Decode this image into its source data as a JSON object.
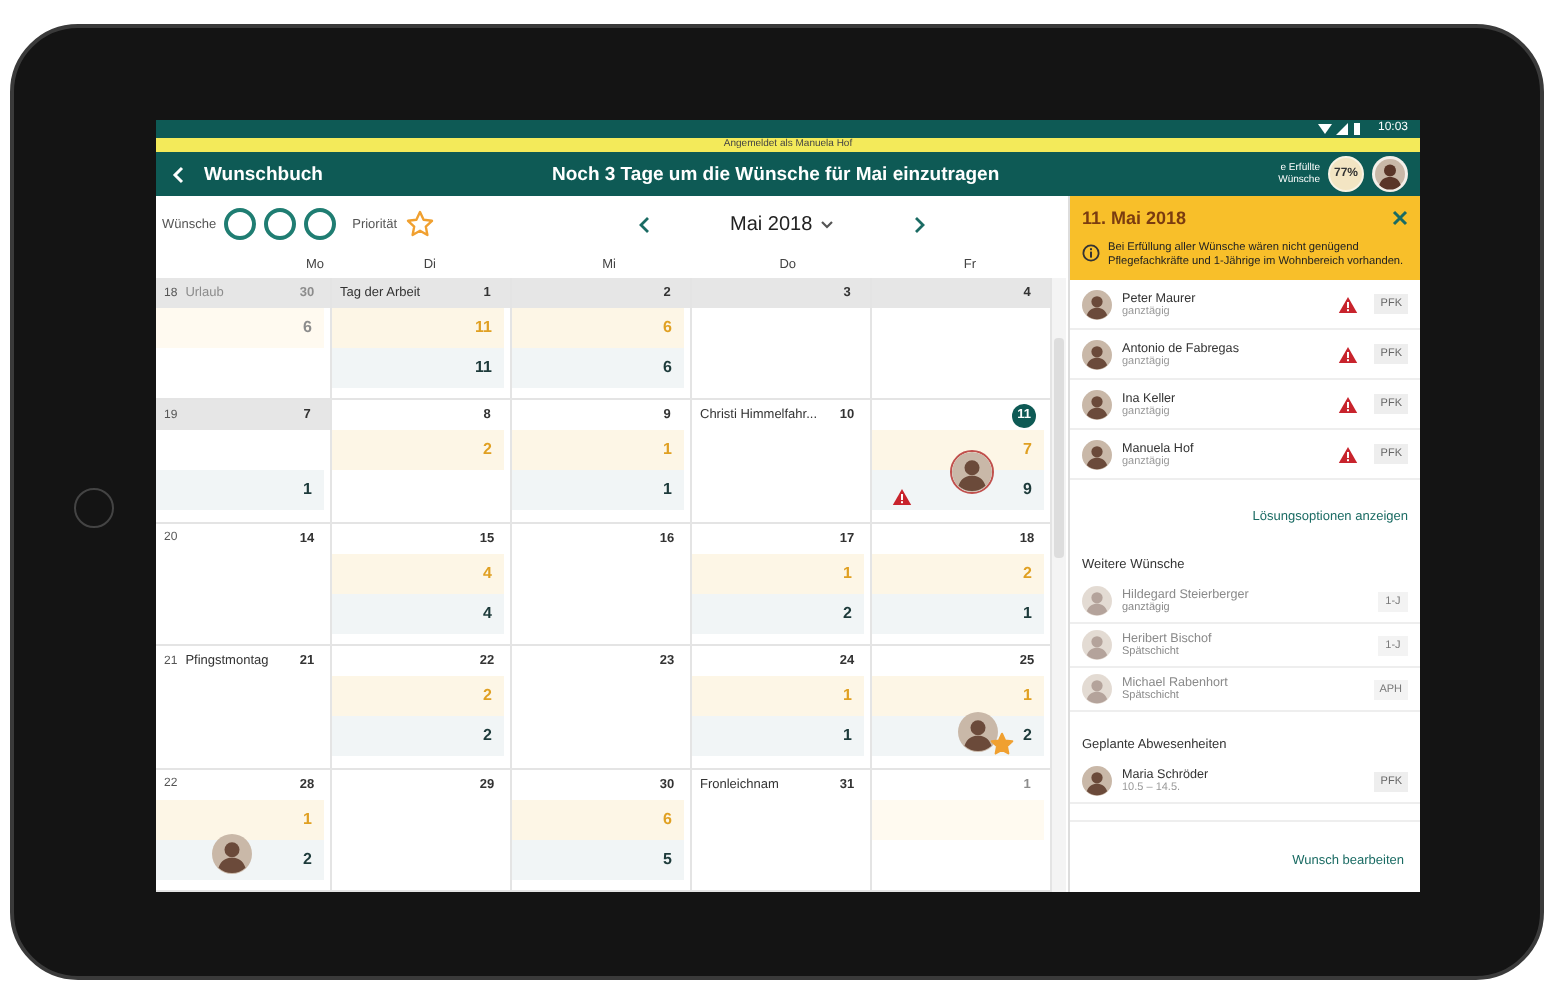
{
  "status_bar": {
    "time": "10:03"
  },
  "banner": {
    "text": "Angemeldet als Manuela Hof"
  },
  "header": {
    "title": "Wunschbuch",
    "headline": "Noch 3 Tage um die Wünsche für Mai einzutragen",
    "fulfilled_label": "e Erfüllte Wünsche",
    "fulfilled_value": "77%"
  },
  "toolbar": {
    "wishes_label": "Wünsche",
    "wish_slots": [
      {
        "used": false
      },
      {
        "used": false
      },
      {
        "used": false
      }
    ],
    "priority_label": "Priorität",
    "priority_set": false,
    "month": "Mai 2018"
  },
  "weekdays": [
    "Mo",
    "Di",
    "Mi",
    "Do",
    "Fr"
  ],
  "weeks": [
    {
      "number": "18",
      "days": [
        {
          "day": "30",
          "label": "Urlaub",
          "past": true,
          "outside": true,
          "selected": false,
          "wishes": "6",
          "warning": false,
          "avatar": false,
          "starred": false
        },
        {
          "day": "1",
          "label": "Tag der Arbeit",
          "past": true,
          "outside": false,
          "selected": false,
          "wishes": "11",
          "staff": "11",
          "warning": false,
          "avatar": false,
          "starred": false
        },
        {
          "day": "2",
          "past": true,
          "outside": false,
          "selected": false,
          "wishes": "6",
          "staff": "6",
          "warning": false,
          "avatar": false,
          "starred": false
        },
        {
          "day": "3",
          "past": true,
          "outside": false,
          "selected": false,
          "warning": false,
          "avatar": false,
          "starred": false
        },
        {
          "day": "4",
          "past": true,
          "outside": false,
          "selected": false,
          "warning": false,
          "avatar": false,
          "starred": false
        }
      ]
    },
    {
      "number": "19",
      "days": [
        {
          "day": "7",
          "past": true,
          "outside": false,
          "selected": false,
          "staff": "1",
          "warning": false,
          "avatar": false,
          "starred": false
        },
        {
          "day": "8",
          "past": false,
          "outside": false,
          "selected": false,
          "wishes": "2",
          "warning": false,
          "avatar": false,
          "starred": false
        },
        {
          "day": "9",
          "past": false,
          "outside": false,
          "selected": false,
          "wishes": "1",
          "staff": "1",
          "warning": false,
          "avatar": false,
          "starred": false
        },
        {
          "day": "10",
          "label": "Christi Himmelfahr...",
          "past": false,
          "outside": false,
          "selected": false,
          "warning": false,
          "avatar": false,
          "starred": false
        },
        {
          "day": "11",
          "past": false,
          "outside": false,
          "selected": true,
          "wishes": "7",
          "staff": "9",
          "warning": true,
          "avatar": true,
          "starred": false
        }
      ]
    },
    {
      "number": "20",
      "days": [
        {
          "day": "14",
          "past": false,
          "outside": false,
          "selected": false,
          "warning": false,
          "avatar": false,
          "starred": false
        },
        {
          "day": "15",
          "past": false,
          "outside": false,
          "selected": false,
          "wishes": "4",
          "staff": "4",
          "warning": false,
          "avatar": false,
          "starred": false
        },
        {
          "day": "16",
          "past": false,
          "outside": false,
          "selected": false,
          "warning": false,
          "avatar": false,
          "starred": false
        },
        {
          "day": "17",
          "past": false,
          "outside": false,
          "selected": false,
          "wishes": "1",
          "staff": "2",
          "warning": false,
          "avatar": false,
          "starred": false
        },
        {
          "day": "18",
          "past": false,
          "outside": false,
          "selected": false,
          "wishes": "2",
          "staff": "1",
          "warning": false,
          "avatar": false,
          "starred": false
        }
      ]
    },
    {
      "number": "21",
      "days": [
        {
          "day": "21",
          "label": "Pfingstmontag",
          "past": false,
          "outside": false,
          "selected": false,
          "warning": false,
          "avatar": false,
          "starred": false
        },
        {
          "day": "22",
          "past": false,
          "outside": false,
          "selected": false,
          "wishes": "2",
          "staff": "2",
          "warning": false,
          "avatar": false,
          "starred": false
        },
        {
          "day": "23",
          "past": false,
          "outside": false,
          "selected": false,
          "warning": false,
          "avatar": false,
          "starred": false
        },
        {
          "day": "24",
          "past": false,
          "outside": false,
          "selected": false,
          "wishes": "1",
          "staff": "1",
          "warning": false,
          "avatar": false,
          "starred": false
        },
        {
          "day": "25",
          "past": false,
          "outside": false,
          "selected": false,
          "wishes": "1",
          "staff": "2",
          "warning": false,
          "avatar": true,
          "starred": true
        }
      ]
    },
    {
      "number": "22",
      "days": [
        {
          "day": "28",
          "past": false,
          "outside": false,
          "selected": false,
          "wishes": "1",
          "staff": "2",
          "warning": false,
          "avatar": true,
          "starred": false
        },
        {
          "day": "29",
          "past": false,
          "outside": false,
          "selected": false,
          "warning": false,
          "avatar": false,
          "starred": false
        },
        {
          "day": "30",
          "past": false,
          "outside": false,
          "selected": false,
          "wishes": "6",
          "staff": "5",
          "warning": false,
          "avatar": false,
          "starred": false
        },
        {
          "day": "31",
          "label": "Fronleichnam",
          "past": false,
          "outside": false,
          "selected": false,
          "warning": false,
          "avatar": false,
          "starred": false
        },
        {
          "day": "1",
          "past": false,
          "outside": true,
          "selected": false,
          "warning": false,
          "avatar": false,
          "starred": false
        }
      ]
    }
  ],
  "detail": {
    "title": "11. Mai 2018",
    "notice": "Bei Erfüllung aller Wünsche wären nicht genügend Pflegefachkräfte und 1-Jährige im Wohnbereich vorhanden.",
    "conflicts": [
      {
        "name": "Peter Maurer",
        "shift": "ganztägig",
        "role": "PFK",
        "warning": true,
        "faded": false
      },
      {
        "name": "Antonio de Fabregas",
        "shift": "ganztägig",
        "role": "PFK",
        "warning": true,
        "faded": false
      },
      {
        "name": "Ina Keller",
        "shift": "ganztägig",
        "role": "PFK",
        "warning": true,
        "faded": false
      },
      {
        "name": "Manuela Hof",
        "shift": "ganztägig",
        "role": "PFK",
        "warning": true,
        "faded": false
      }
    ],
    "link": "Lösungsoptionen anzeigen",
    "more_title": "Weitere Wünsche",
    "more": [
      {
        "name": "Hildegard Steierberger",
        "shift": "ganztägig",
        "role": "1-J",
        "warning": false,
        "faded": true
      },
      {
        "name": "Heribert Bischof",
        "shift": "Spätschicht",
        "role": "1-J",
        "warning": false,
        "faded": true
      },
      {
        "name": "Michael Rabenhort",
        "shift": "Spätschicht",
        "role": "APH",
        "warning": false,
        "faded": true
      }
    ],
    "absences_title": "Geplante Abwesenheiten",
    "absences": [
      {
        "name": "Maria Schröder",
        "shift": "10.5 – 14.5.",
        "role": "PFK",
        "warning": false,
        "faded": false
      }
    ],
    "action": "Wunsch bearbeiten"
  }
}
